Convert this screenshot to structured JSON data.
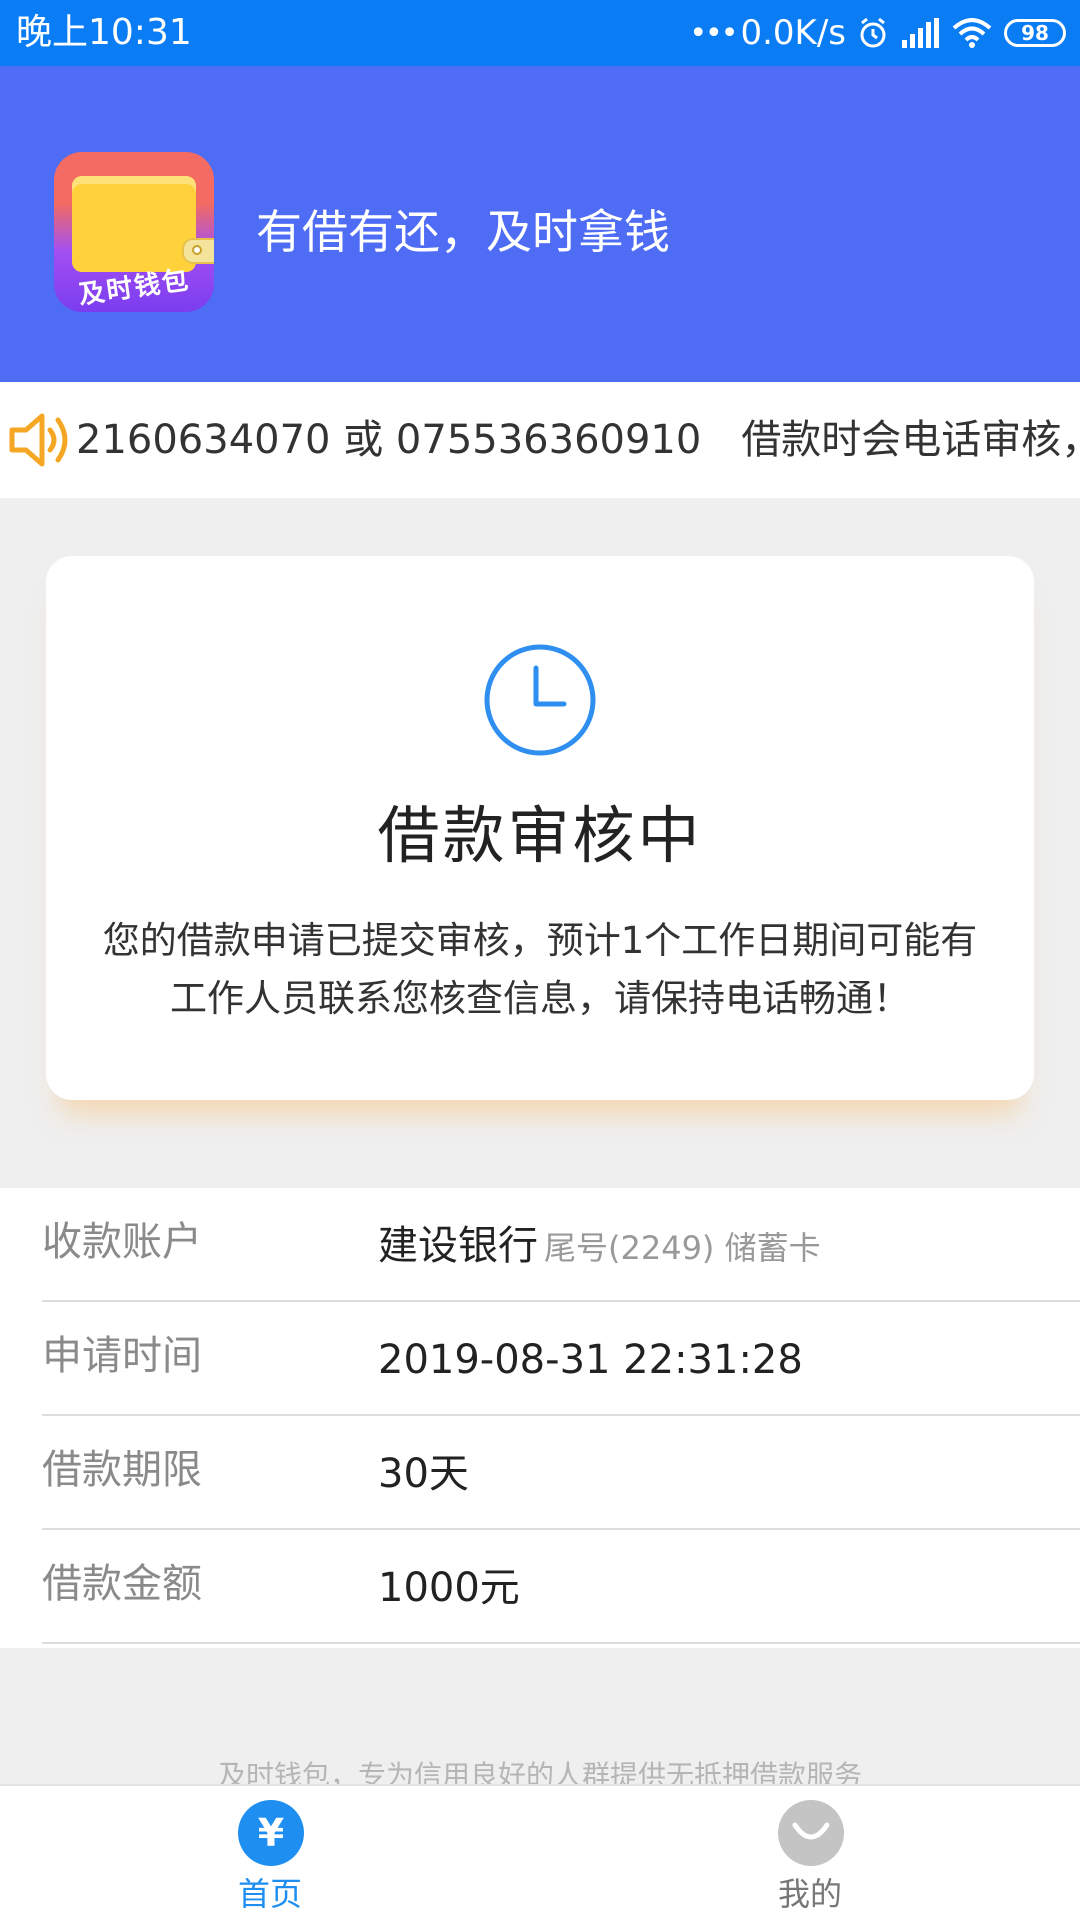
{
  "status_bar": {
    "time": "晚上10:31",
    "network_speed": "0.0K/s",
    "battery": "98"
  },
  "header": {
    "logo_text": "及时钱包",
    "slogan": "有借有还，及时拿钱"
  },
  "notice": {
    "text": "2160634070 或 075536360910　借款时会电话审核，"
  },
  "status_card": {
    "title": "借款审核中",
    "description": "您的借款申请已提交审核，预计1个工作日期间可能有工作人员联系您核查信息，请保持电话畅通！"
  },
  "details": {
    "account": {
      "label": "收款账户",
      "bank": "建设银行",
      "sub": "尾号(2249) 储蓄卡"
    },
    "apply_time": {
      "label": "申请时间",
      "value": "2019-08-31 22:31:28"
    },
    "term": {
      "label": "借款期限",
      "value": "30天"
    },
    "amount": {
      "label": "借款金额",
      "value": "1000元"
    }
  },
  "footer_note": "及时钱包，专为信用良好的人群提供无抵押借款服务",
  "nav": {
    "home_label": "首页",
    "home_icon": "¥",
    "mine_label": "我的"
  },
  "colors": {
    "status_bar": "#0a7cf4",
    "header": "#4f6cf5",
    "nav_active": "#1e8ff0",
    "nav_inactive": "#c4c4c4"
  }
}
